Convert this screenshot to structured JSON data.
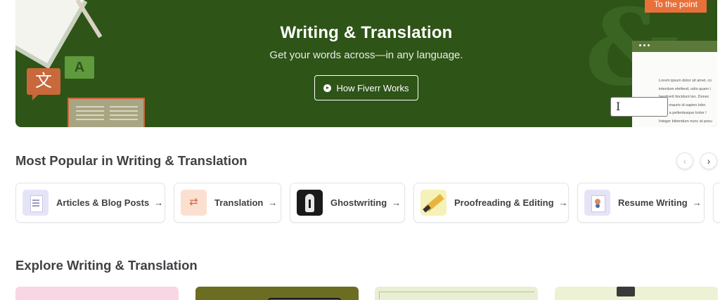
{
  "hero": {
    "title": "Writing & Translation",
    "subtitle": "Get your words across—in any language.",
    "button_label": "How Fiverr Works",
    "decor_tag": "To the point",
    "decor_glyph_cjk": "文",
    "decor_glyph_a": "A",
    "decor_amp": "&",
    "decor_doc_lines": [
      "Lorem ipsum dolor sit amet, co",
      "interdum eleifend, odio quam i",
      "hendrerit tincidunt leo. Donec",
      "lacus mauris id sapien lobo",
      "vitae, a pellentesque tortor l",
      "Integer bibendum nunc at posu"
    ],
    "colors": {
      "hero_bg": "#2e5418",
      "accent_orange": "#e8703a"
    }
  },
  "popular": {
    "title": "Most Popular in Writing & Translation",
    "prev_icon": "chevron-left-icon",
    "next_icon": "chevron-right-icon",
    "items": [
      {
        "label": "Articles & Blog Posts",
        "icon": "articles-icon"
      },
      {
        "label": "Translation",
        "icon": "translation-icon"
      },
      {
        "label": "Ghostwriting",
        "icon": "ghostwriting-icon"
      },
      {
        "label": "Proofreading & Editing",
        "icon": "proofreading-icon"
      },
      {
        "label": "Resume Writing",
        "icon": "resume-icon"
      }
    ],
    "arrow": "→"
  },
  "explore": {
    "title": "Explore Writing & Translation"
  }
}
